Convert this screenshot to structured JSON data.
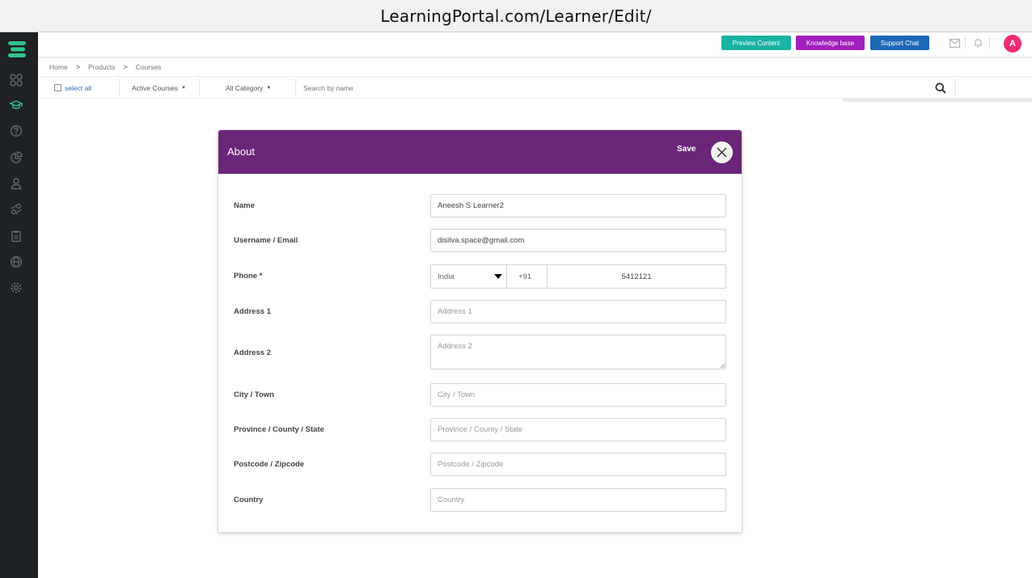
{
  "browser": {
    "url": "LearningPortal.com/Learner/Edit/"
  },
  "sidebar": {
    "icons": [
      "dashboard-icon",
      "courses-icon",
      "help-icon",
      "analytics-icon",
      "users-icon",
      "groups-icon",
      "reports-icon",
      "globe-icon",
      "settings-icon"
    ]
  },
  "header": {
    "preview_label": "Preview Content",
    "kb_label": "Knowledge base",
    "chat_label": "Support Chat",
    "avatar_initial": "A",
    "colors": {
      "preview": "#1ab2a4",
      "kb": "#a11fbd",
      "chat": "#1e68b7",
      "avatar": "#ef2c74"
    }
  },
  "breadcrumb": [
    "Home",
    "Products",
    "Courses"
  ],
  "filters": {
    "select_all": "select all",
    "active_courses": "Active Courses",
    "all_category": "All Category",
    "search_placeholder": "Search by name"
  },
  "modal": {
    "title": "About",
    "save_label": "Save",
    "header_color": "#6b2579",
    "fields": {
      "name": {
        "label": "Name",
        "value": "Aneesh S Learner2"
      },
      "username": {
        "label": "Username / Email",
        "value": "disilva.space@gmail.com"
      },
      "phone": {
        "label": "Phone *",
        "country": "India",
        "code": "+91",
        "number": "5412121"
      },
      "address1": {
        "label": "Address 1",
        "placeholder": "Address 1"
      },
      "address2": {
        "label": "Address 2",
        "placeholder": "Address 2"
      },
      "city": {
        "label": "City / Town",
        "placeholder": "City / Town"
      },
      "province": {
        "label": "Province / County / State",
        "placeholder": "Province / County / State"
      },
      "postcode": {
        "label": "Postcode / Zipcode",
        "placeholder": "Postcode / Zipcode"
      },
      "country": {
        "label": "Country",
        "placeholder": "Country"
      }
    }
  }
}
